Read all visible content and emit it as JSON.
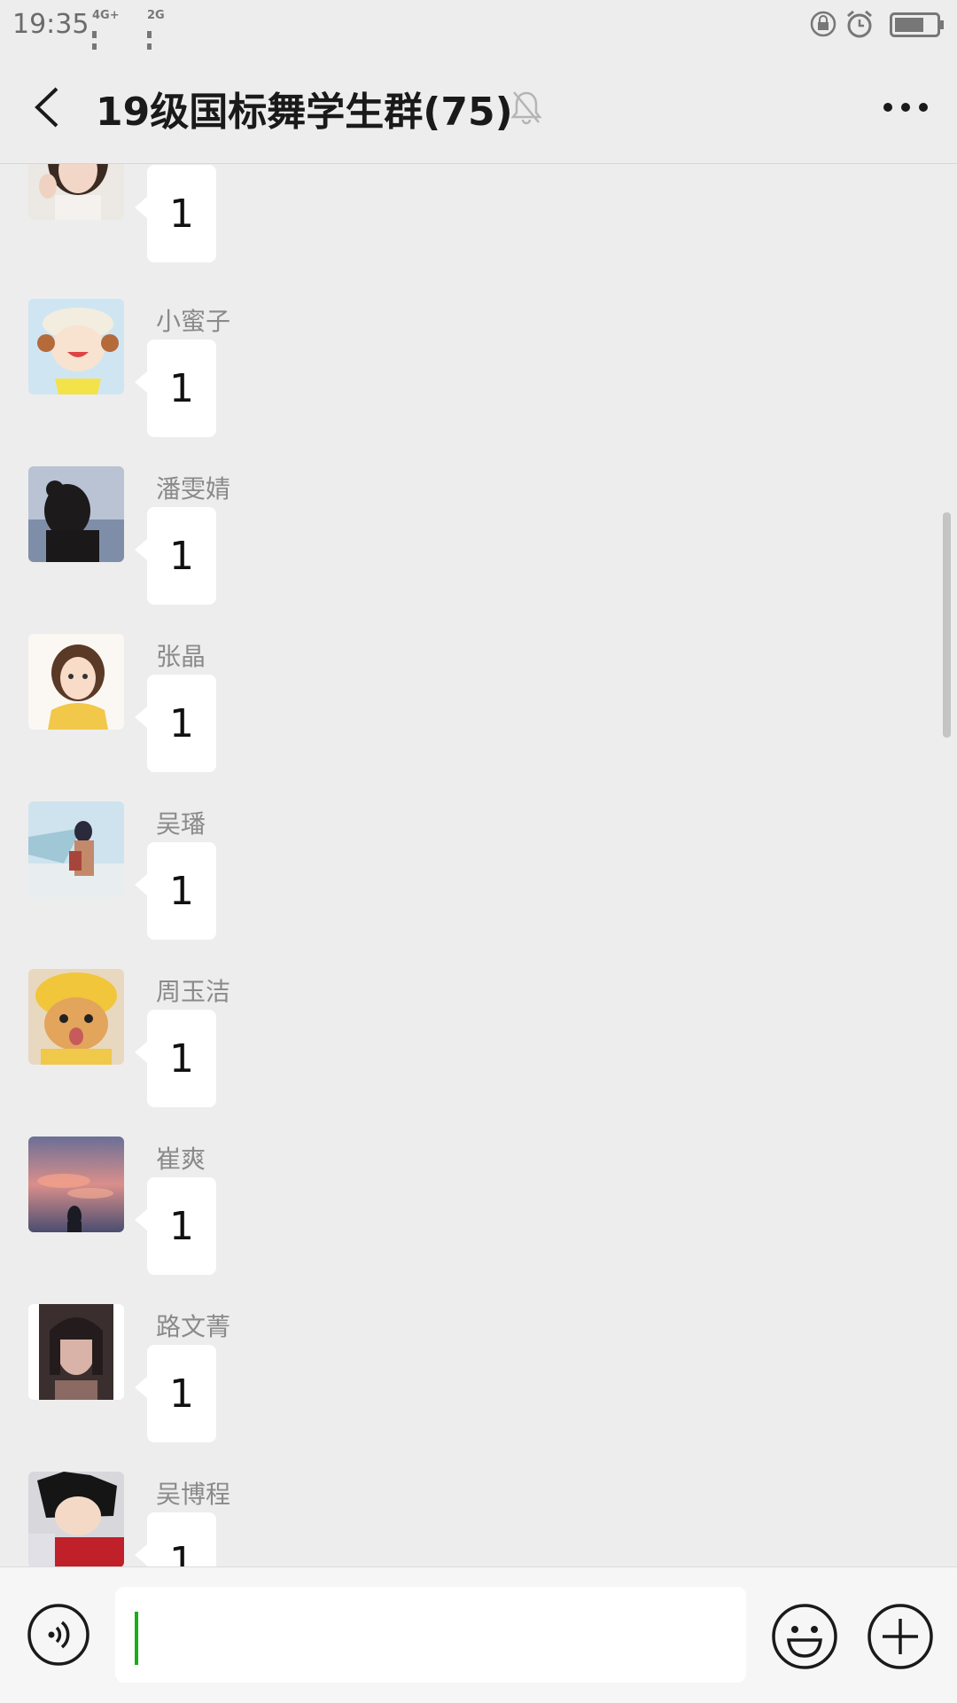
{
  "status_bar": {
    "time": "19:35",
    "network_1": "4G+",
    "network_2": "2G",
    "icons": [
      "lock-rotation-icon",
      "alarm-icon",
      "battery-icon"
    ]
  },
  "header": {
    "title": "19级国标舞学生群(75)",
    "icons": [
      "back-icon",
      "mute-bell-icon",
      "more-icon"
    ]
  },
  "messages": [
    {
      "sender": "",
      "text": "1",
      "avatar": "girl-photo-avatar"
    },
    {
      "sender": "小蜜子",
      "text": "1",
      "avatar": "cartoon-kid-avatar"
    },
    {
      "sender": "潘雯婧",
      "text": "1",
      "avatar": "beach-silhouette-avatar"
    },
    {
      "sender": "张晶",
      "text": "1",
      "avatar": "cartoon-girl-avatar"
    },
    {
      "sender": "吴璠",
      "text": "1",
      "avatar": "anime-girl-avatar"
    },
    {
      "sender": "周玉洁",
      "text": "1",
      "avatar": "cat-avatar"
    },
    {
      "sender": "崔爽",
      "text": "1",
      "avatar": "sunset-sky-avatar"
    },
    {
      "sender": "路文菁",
      "text": "1",
      "avatar": "selfie-avatar"
    },
    {
      "sender": "吴博程",
      "text": "1",
      "avatar": "anime-boy-avatar"
    }
  ],
  "input_bar": {
    "text_value": "",
    "icons": [
      "voice-icon",
      "emoji-icon",
      "plus-icon"
    ]
  },
  "colors": {
    "background": "#ededed",
    "bubble": "#ffffff",
    "caret": "#1aad19"
  }
}
